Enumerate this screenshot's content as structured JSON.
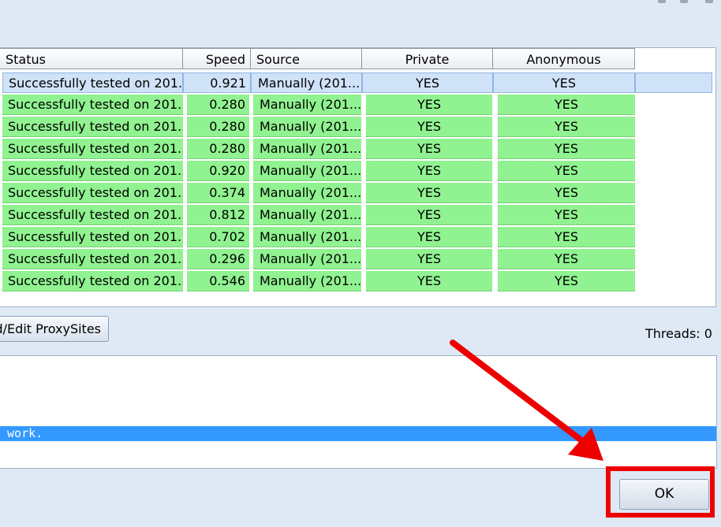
{
  "table": {
    "columns": [
      "Status",
      "Speed",
      "Source",
      "Private",
      "Anonymous"
    ],
    "rows": [
      {
        "status": "Successfully tested on 201...",
        "speed": "0.921",
        "source": "Manually (201...",
        "private": "YES",
        "anonymous": "YES"
      },
      {
        "status": "Successfully tested on 201...",
        "speed": "0.280",
        "source": "Manually (201...",
        "private": "YES",
        "anonymous": "YES"
      },
      {
        "status": "Successfully tested on 201...",
        "speed": "0.280",
        "source": "Manually (201...",
        "private": "YES",
        "anonymous": "YES"
      },
      {
        "status": "Successfully tested on 201...",
        "speed": "0.280",
        "source": "Manually (201...",
        "private": "YES",
        "anonymous": "YES"
      },
      {
        "status": "Successfully tested on 201...",
        "speed": "0.920",
        "source": "Manually (201...",
        "private": "YES",
        "anonymous": "YES"
      },
      {
        "status": "Successfully tested on 201...",
        "speed": "0.374",
        "source": "Manually (201...",
        "private": "YES",
        "anonymous": "YES"
      },
      {
        "status": "Successfully tested on 201...",
        "speed": "0.812",
        "source": "Manually (201...",
        "private": "YES",
        "anonymous": "YES"
      },
      {
        "status": "Successfully tested on 201...",
        "speed": "0.702",
        "source": "Manually (201...",
        "private": "YES",
        "anonymous": "YES"
      },
      {
        "status": "Successfully tested on 201...",
        "speed": "0.296",
        "source": "Manually (201...",
        "private": "YES",
        "anonymous": "YES"
      },
      {
        "status": "Successfully tested on 201...",
        "speed": "0.546",
        "source": "Manually (201...",
        "private": "YES",
        "anonymous": "YES"
      }
    ],
    "selected_row": 0,
    "row_color_ok": "#90f290",
    "row_color_selected": "#cfe2f7"
  },
  "buttons": {
    "edit_proxysites": "d/Edit ProxySites",
    "ok": "OK"
  },
  "threads_label": "Threads: 0",
  "log": {
    "selected_line": " work."
  },
  "annotation": {
    "color": "#ee0000"
  }
}
